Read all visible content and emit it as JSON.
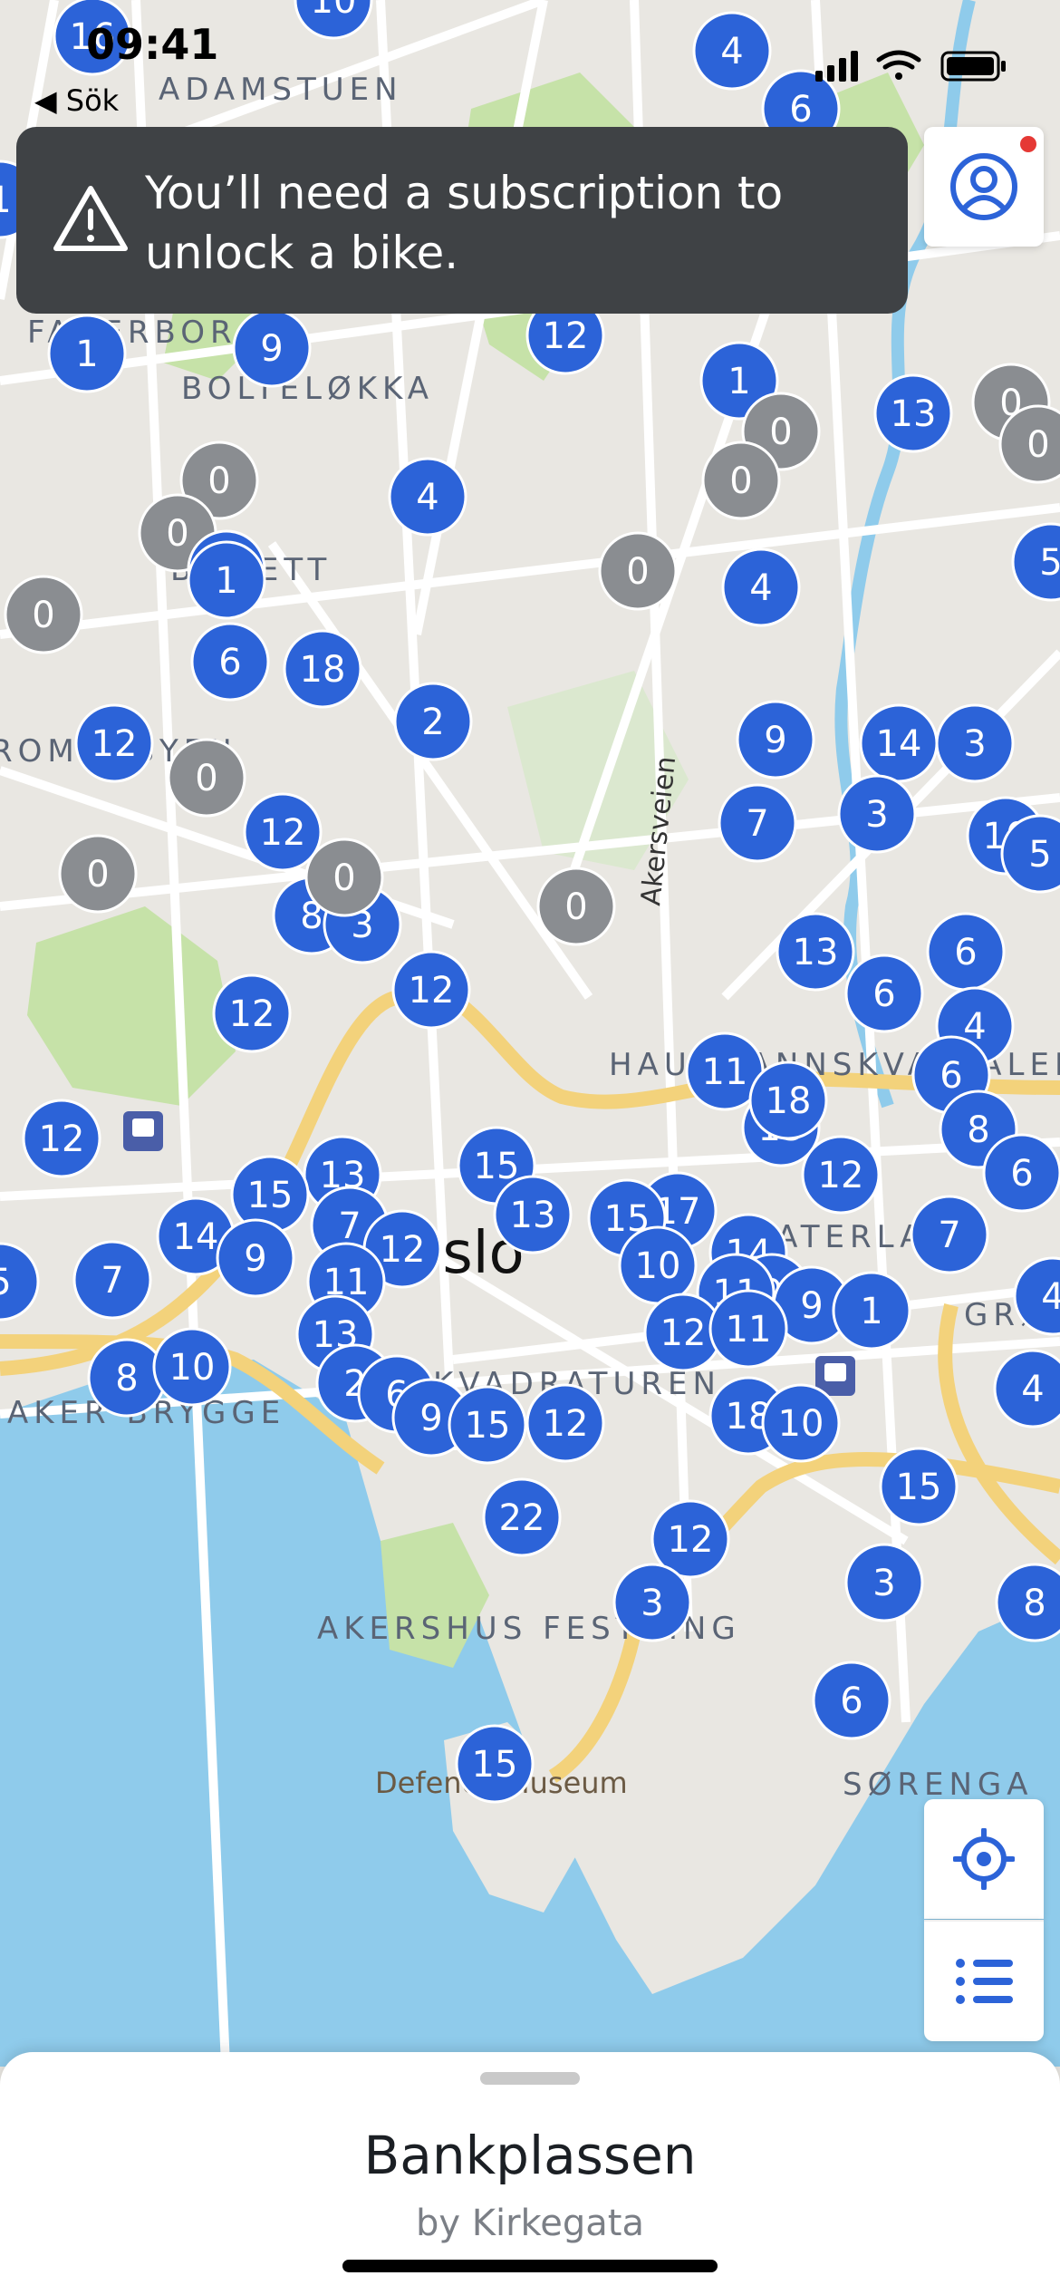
{
  "status_bar": {
    "time": "09:41",
    "back_label": "◀ Sök"
  },
  "banner": {
    "icon": "warning-triangle-icon",
    "message": "You’ll need a subscription to unlock a bike."
  },
  "profile_button": {
    "icon": "user-profile-icon",
    "notification_dot": true
  },
  "map": {
    "city_label": "Oslo",
    "area_labels": [
      "ADAMSTUEN",
      "FAGERBORG",
      "BOLTELØKKA",
      "BISLETT",
      "HAUSMANNSKVARTALENE",
      "VATERLAND",
      "GRØNLAND",
      "KVADRATUREN",
      "AKER BRYGGE",
      "AKERSHUS FESTNING",
      "SØRENGA",
      "ROMANSYEN"
    ],
    "street_labels": [
      "Akersveien"
    ],
    "poi_labels": [
      "Defence Museum"
    ],
    "colors": {
      "available": "#2c63d8",
      "empty": "#8a8d91",
      "water": "#8fcbeb",
      "park": "#c6e2a8",
      "major_road": "#f3d27b"
    },
    "stations": [
      {
        "bikes": "16",
        "empty": false
      },
      {
        "bikes": "10",
        "empty": false
      },
      {
        "bikes": "4",
        "empty": false
      },
      {
        "bikes": "6",
        "empty": false
      },
      {
        "bikes": "1",
        "empty": false
      },
      {
        "bikes": "1",
        "empty": false
      },
      {
        "bikes": "9",
        "empty": false
      },
      {
        "bikes": "12",
        "empty": false
      },
      {
        "bikes": "1",
        "empty": false
      },
      {
        "bikes": "13",
        "empty": false
      },
      {
        "bikes": "0",
        "empty": true
      },
      {
        "bikes": "0",
        "empty": true
      },
      {
        "bikes": "0",
        "empty": true
      },
      {
        "bikes": "0",
        "empty": true
      },
      {
        "bikes": "0",
        "empty": true
      },
      {
        "bikes": "4",
        "empty": false
      },
      {
        "bikes": "1",
        "empty": false
      },
      {
        "bikes": "0",
        "empty": true
      },
      {
        "bikes": "0",
        "empty": true
      },
      {
        "bikes": "0",
        "empty": true
      },
      {
        "bikes": "4",
        "empty": false
      },
      {
        "bikes": "5",
        "empty": false
      },
      {
        "bikes": "1",
        "empty": false
      },
      {
        "bikes": "6",
        "empty": false
      },
      {
        "bikes": "18",
        "empty": false
      },
      {
        "bikes": "2",
        "empty": false
      },
      {
        "bikes": "9",
        "empty": false
      },
      {
        "bikes": "14",
        "empty": false
      },
      {
        "bikes": "3",
        "empty": false
      },
      {
        "bikes": "12",
        "empty": false
      },
      {
        "bikes": "0",
        "empty": true
      },
      {
        "bikes": "7",
        "empty": false
      },
      {
        "bikes": "3",
        "empty": false
      },
      {
        "bikes": "10",
        "empty": false
      },
      {
        "bikes": "5",
        "empty": false
      },
      {
        "bikes": "0",
        "empty": true
      },
      {
        "bikes": "12",
        "empty": false
      },
      {
        "bikes": "8",
        "empty": false
      },
      {
        "bikes": "3",
        "empty": false
      },
      {
        "bikes": "0",
        "empty": true
      },
      {
        "bikes": "0",
        "empty": true
      },
      {
        "bikes": "13",
        "empty": false
      },
      {
        "bikes": "6",
        "empty": false
      },
      {
        "bikes": "6",
        "empty": false
      },
      {
        "bikes": "4",
        "empty": false
      },
      {
        "bikes": "6",
        "empty": false
      },
      {
        "bikes": "12",
        "empty": false
      },
      {
        "bikes": "12",
        "empty": false
      },
      {
        "bikes": "11",
        "empty": false
      },
      {
        "bikes": "13",
        "empty": false
      },
      {
        "bikes": "18",
        "empty": false
      },
      {
        "bikes": "8",
        "empty": false
      },
      {
        "bikes": "6",
        "empty": false
      },
      {
        "bikes": "12",
        "empty": false
      },
      {
        "bikes": "12",
        "empty": false
      },
      {
        "bikes": "15",
        "empty": false
      },
      {
        "bikes": "13",
        "empty": false
      },
      {
        "bikes": "13",
        "empty": false
      },
      {
        "bikes": "15",
        "empty": false
      },
      {
        "bikes": "17",
        "empty": false
      },
      {
        "bikes": "15",
        "empty": false
      },
      {
        "bikes": "14",
        "empty": false
      },
      {
        "bikes": "7",
        "empty": false
      },
      {
        "bikes": "12",
        "empty": false
      },
      {
        "bikes": "7",
        "empty": false
      },
      {
        "bikes": "9",
        "empty": false
      },
      {
        "bikes": "10",
        "empty": false
      },
      {
        "bikes": "14",
        "empty": false
      },
      {
        "bikes": "9",
        "empty": false
      },
      {
        "bikes": "9",
        "empty": false
      },
      {
        "bikes": "1",
        "empty": false
      },
      {
        "bikes": "11",
        "empty": false
      },
      {
        "bikes": "5",
        "empty": false
      },
      {
        "bikes": "7",
        "empty": false
      },
      {
        "bikes": "11",
        "empty": false
      },
      {
        "bikes": "12",
        "empty": false
      },
      {
        "bikes": "11",
        "empty": false
      },
      {
        "bikes": "4",
        "empty": false
      },
      {
        "bikes": "13",
        "empty": false
      },
      {
        "bikes": "8",
        "empty": false
      },
      {
        "bikes": "10",
        "empty": false
      },
      {
        "bikes": "2",
        "empty": false
      },
      {
        "bikes": "6",
        "empty": false
      },
      {
        "bikes": "9",
        "empty": false
      },
      {
        "bikes": "15",
        "empty": false
      },
      {
        "bikes": "12",
        "empty": false
      },
      {
        "bikes": "18",
        "empty": false
      },
      {
        "bikes": "10",
        "empty": false
      },
      {
        "bikes": "4",
        "empty": false
      },
      {
        "bikes": "15",
        "empty": false
      },
      {
        "bikes": "22",
        "empty": false
      },
      {
        "bikes": "12",
        "empty": false
      },
      {
        "bikes": "3",
        "empty": false
      },
      {
        "bikes": "3",
        "empty": false
      },
      {
        "bikes": "8",
        "empty": false
      },
      {
        "bikes": "6",
        "empty": false
      },
      {
        "bikes": "15",
        "empty": false
      }
    ]
  },
  "controls": {
    "locate_icon": "crosshair-locate-icon",
    "list_icon": "list-icon"
  },
  "bottom_sheet": {
    "station_name": "Bankplassen",
    "subtitle": "by Kirkegata"
  }
}
